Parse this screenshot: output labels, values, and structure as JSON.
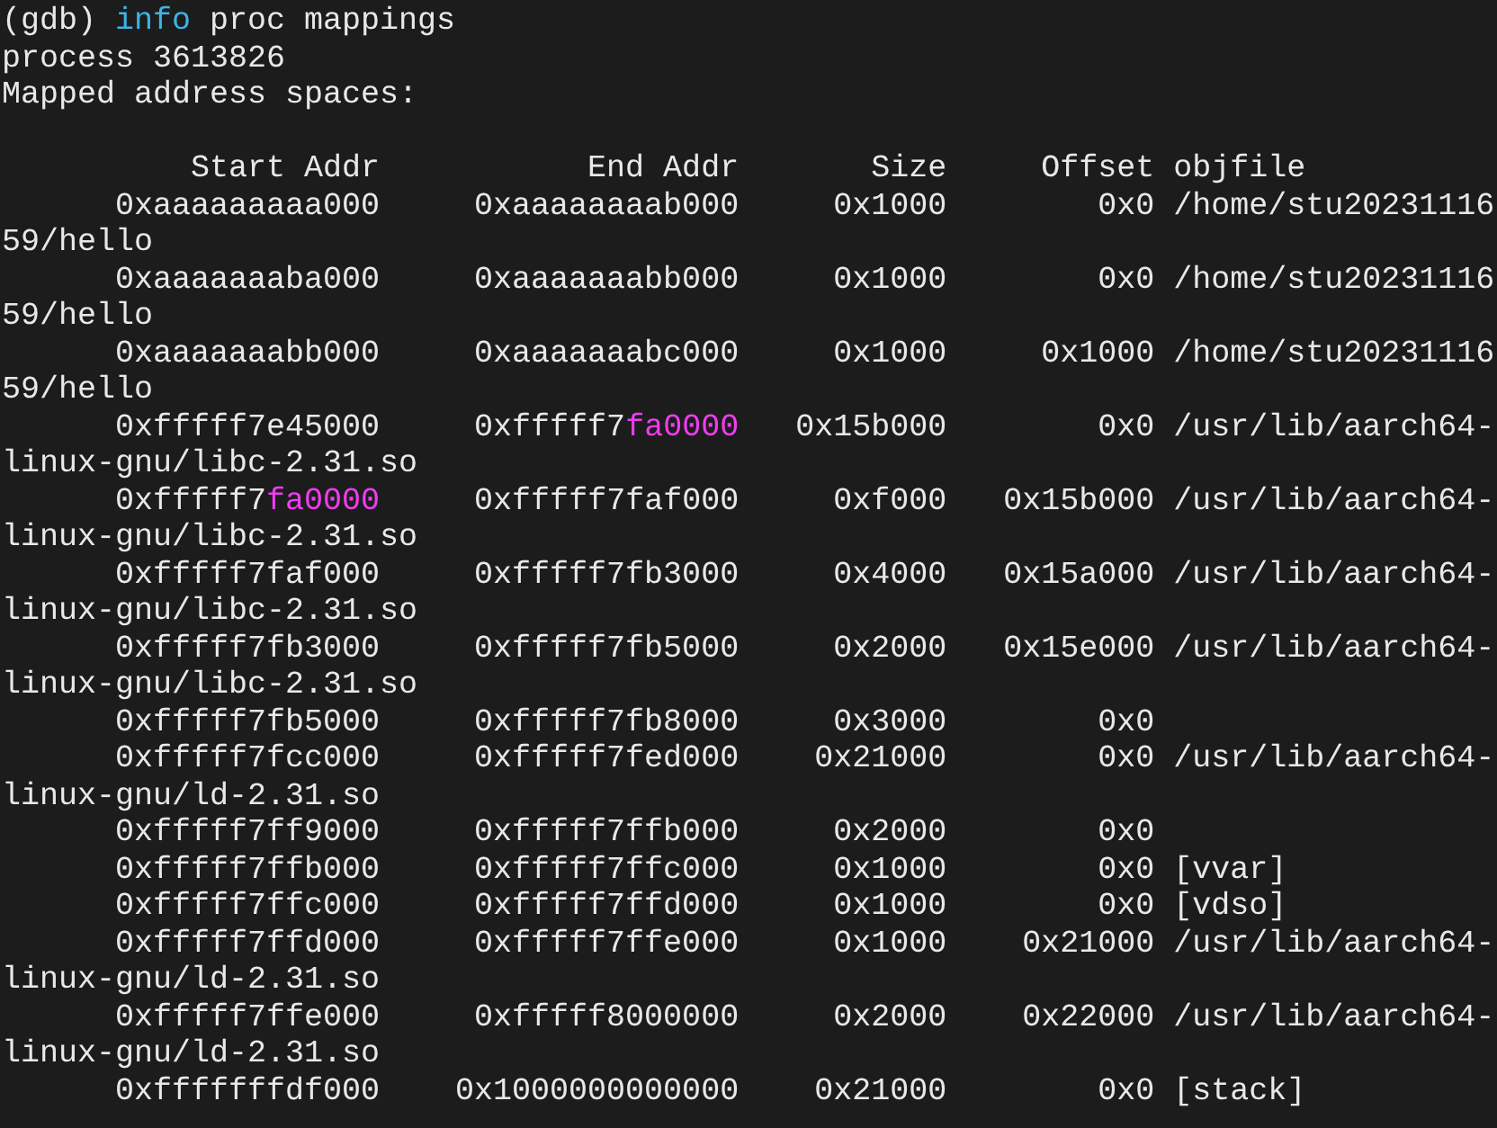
{
  "terminal": {
    "lines": [
      {
        "segments": [
          {
            "kind": "plain",
            "text": "(gdb) "
          },
          {
            "kind": "keyword",
            "text": "info"
          },
          {
            "kind": "plain",
            "text": " proc mappings"
          }
        ]
      },
      {
        "segments": [
          {
            "kind": "plain",
            "text": "process 3613826"
          }
        ]
      },
      {
        "segments": [
          {
            "kind": "plain",
            "text": "Mapped address spaces:"
          }
        ]
      },
      {
        "kind": "blank"
      },
      {
        "segments": [
          {
            "kind": "plain",
            "text": "          Start Addr           End Addr       Size     Offset objfile"
          }
        ]
      },
      {
        "segments": [
          {
            "kind": "plain",
            "text": "      0xaaaaaaaaa000     0xaaaaaaaab000     0x1000        0x0 /home/stu20231116"
          }
        ]
      },
      {
        "segments": [
          {
            "kind": "plain",
            "text": "59/hello"
          }
        ]
      },
      {
        "segments": [
          {
            "kind": "plain",
            "text": "      0xaaaaaaaba000     0xaaaaaaabb000     0x1000        0x0 /home/stu20231116"
          }
        ]
      },
      {
        "segments": [
          {
            "kind": "plain",
            "text": "59/hello"
          }
        ]
      },
      {
        "segments": [
          {
            "kind": "plain",
            "text": "      0xaaaaaaabb000     0xaaaaaaabc000     0x1000     0x1000 /home/stu20231116"
          }
        ]
      },
      {
        "segments": [
          {
            "kind": "plain",
            "text": "59/hello"
          }
        ]
      },
      {
        "segments": [
          {
            "kind": "plain",
            "text": "      0xfffff7e45000     0xfffff7"
          },
          {
            "kind": "match",
            "text": "fa0000"
          },
          {
            "kind": "plain",
            "text": "   0x15b000        0x0 /usr/lib/aarch64-"
          }
        ]
      },
      {
        "segments": [
          {
            "kind": "plain",
            "text": "linux-gnu/libc-2.31.so"
          }
        ]
      },
      {
        "segments": [
          {
            "kind": "plain",
            "text": "      0xfffff7"
          },
          {
            "kind": "match",
            "text": "fa0000"
          },
          {
            "kind": "plain",
            "text": "     0xfffff7faf000     0xf000   0x15b000 /usr/lib/aarch64-"
          }
        ]
      },
      {
        "segments": [
          {
            "kind": "plain",
            "text": "linux-gnu/libc-2.31.so"
          }
        ]
      },
      {
        "segments": [
          {
            "kind": "plain",
            "text": "      0xfffff7faf000     0xfffff7fb3000     0x4000   0x15a000 /usr/lib/aarch64-"
          }
        ]
      },
      {
        "segments": [
          {
            "kind": "plain",
            "text": "linux-gnu/libc-2.31.so"
          }
        ]
      },
      {
        "segments": [
          {
            "kind": "plain",
            "text": "      0xfffff7fb3000     0xfffff7fb5000     0x2000   0x15e000 /usr/lib/aarch64-"
          }
        ]
      },
      {
        "segments": [
          {
            "kind": "plain",
            "text": "linux-gnu/libc-2.31.so"
          }
        ]
      },
      {
        "segments": [
          {
            "kind": "plain",
            "text": "      0xfffff7fb5000     0xfffff7fb8000     0x3000        0x0"
          }
        ]
      },
      {
        "segments": [
          {
            "kind": "plain",
            "text": "      0xfffff7fcc000     0xfffff7fed000    0x21000        0x0 /usr/lib/aarch64-"
          }
        ]
      },
      {
        "segments": [
          {
            "kind": "plain",
            "text": "linux-gnu/ld-2.31.so"
          }
        ]
      },
      {
        "segments": [
          {
            "kind": "plain",
            "text": "      0xfffff7ff9000     0xfffff7ffb000     0x2000        0x0"
          }
        ]
      },
      {
        "segments": [
          {
            "kind": "plain",
            "text": "      0xfffff7ffb000     0xfffff7ffc000     0x1000        0x0 [vvar]"
          }
        ]
      },
      {
        "segments": [
          {
            "kind": "plain",
            "text": "      0xfffff7ffc000     0xfffff7ffd000     0x1000        0x0 [vdso]"
          }
        ]
      },
      {
        "segments": [
          {
            "kind": "plain",
            "text": "      0xfffff7ffd000     0xfffff7ffe000     0x1000    0x21000 /usr/lib/aarch64-"
          }
        ]
      },
      {
        "segments": [
          {
            "kind": "plain",
            "text": "linux-gnu/ld-2.31.so"
          }
        ]
      },
      {
        "segments": [
          {
            "kind": "plain",
            "text": "      0xfffff7ffe000     0xfffff8000000     0x2000    0x22000 /usr/lib/aarch64-"
          }
        ]
      },
      {
        "segments": [
          {
            "kind": "plain",
            "text": "linux-gnu/ld-2.31.so"
          }
        ]
      },
      {
        "segments": [
          {
            "kind": "plain",
            "text": "      0xfffffffdf000    0x1000000000000    0x21000        0x0 [stack]"
          }
        ]
      }
    ]
  }
}
